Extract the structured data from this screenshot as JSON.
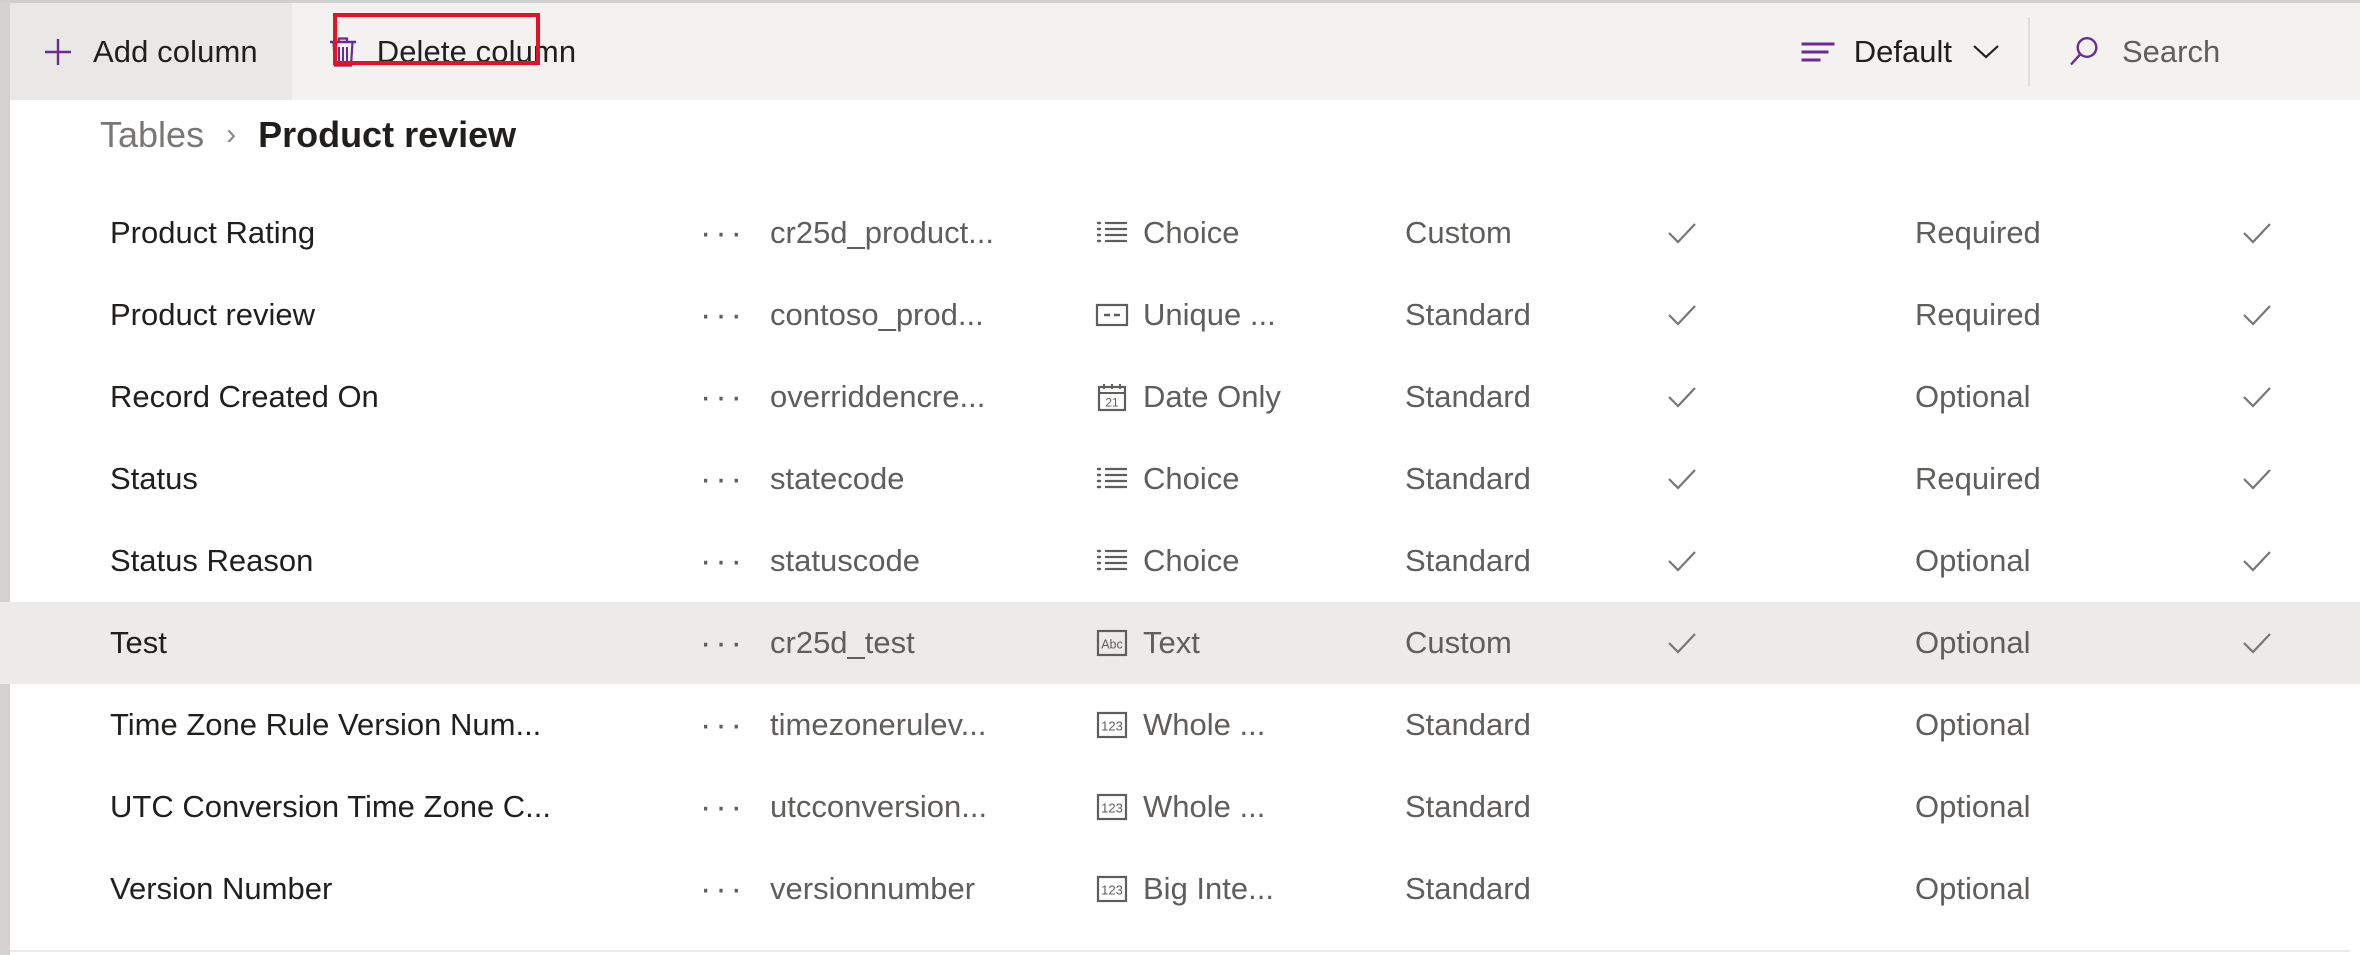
{
  "toolbar": {
    "add_column_label": "Add column",
    "delete_column_label": "Delete column",
    "view_label": "Default",
    "search_placeholder": "Search",
    "accent_color": "#6b2c91",
    "annotation_color": "#e81123"
  },
  "breadcrumb": {
    "parent": "Tables",
    "separator": "›",
    "current": "Product review"
  },
  "grid": {
    "rows": [
      {
        "display_name": "Product Rating",
        "logical_name": "cr25d_product...",
        "data_type": "Choice",
        "type_icon": "choice-icon",
        "type_category": "Custom",
        "customizable": "✓",
        "requirement": "Required",
        "searchable": "✓",
        "selected": false
      },
      {
        "display_name": "Product review",
        "logical_name": "contoso_prod...",
        "data_type": "Unique ...",
        "type_icon": "unique-identifier-icon",
        "type_category": "Standard",
        "customizable": "✓",
        "requirement": "Required",
        "searchable": "✓",
        "selected": false
      },
      {
        "display_name": "Record Created On",
        "logical_name": "overriddencre...",
        "data_type": "Date Only",
        "type_icon": "calendar-icon",
        "type_category": "Standard",
        "customizable": "✓",
        "requirement": "Optional",
        "searchable": "✓",
        "selected": false
      },
      {
        "display_name": "Status",
        "logical_name": "statecode",
        "data_type": "Choice",
        "type_icon": "choice-icon",
        "type_category": "Standard",
        "customizable": "✓",
        "requirement": "Required",
        "searchable": "✓",
        "selected": false
      },
      {
        "display_name": "Status Reason",
        "logical_name": "statuscode",
        "data_type": "Choice",
        "type_icon": "choice-icon",
        "type_category": "Standard",
        "customizable": "✓",
        "requirement": "Optional",
        "searchable": "✓",
        "selected": false
      },
      {
        "display_name": "Test",
        "logical_name": "cr25d_test",
        "data_type": "Text",
        "type_icon": "text-abc-icon",
        "type_category": "Custom",
        "customizable": "✓",
        "requirement": "Optional",
        "searchable": "✓",
        "selected": true
      },
      {
        "display_name": "Time Zone Rule Version Num...",
        "logical_name": "timezonerulev...",
        "data_type": "Whole ...",
        "type_icon": "number-123-icon",
        "type_category": "Standard",
        "customizable": "",
        "requirement": "Optional",
        "searchable": "",
        "selected": false
      },
      {
        "display_name": "UTC Conversion Time Zone C...",
        "logical_name": "utcconversion...",
        "data_type": "Whole ...",
        "type_icon": "number-123-icon",
        "type_category": "Standard",
        "customizable": "",
        "requirement": "Optional",
        "searchable": "",
        "selected": false
      },
      {
        "display_name": "Version Number",
        "logical_name": "versionnumber",
        "data_type": "Big Inte...",
        "type_icon": "number-123-icon",
        "type_category": "Standard",
        "customizable": "",
        "requirement": "Optional",
        "searchable": "",
        "selected": false
      }
    ],
    "overflow_glyph": "···"
  }
}
